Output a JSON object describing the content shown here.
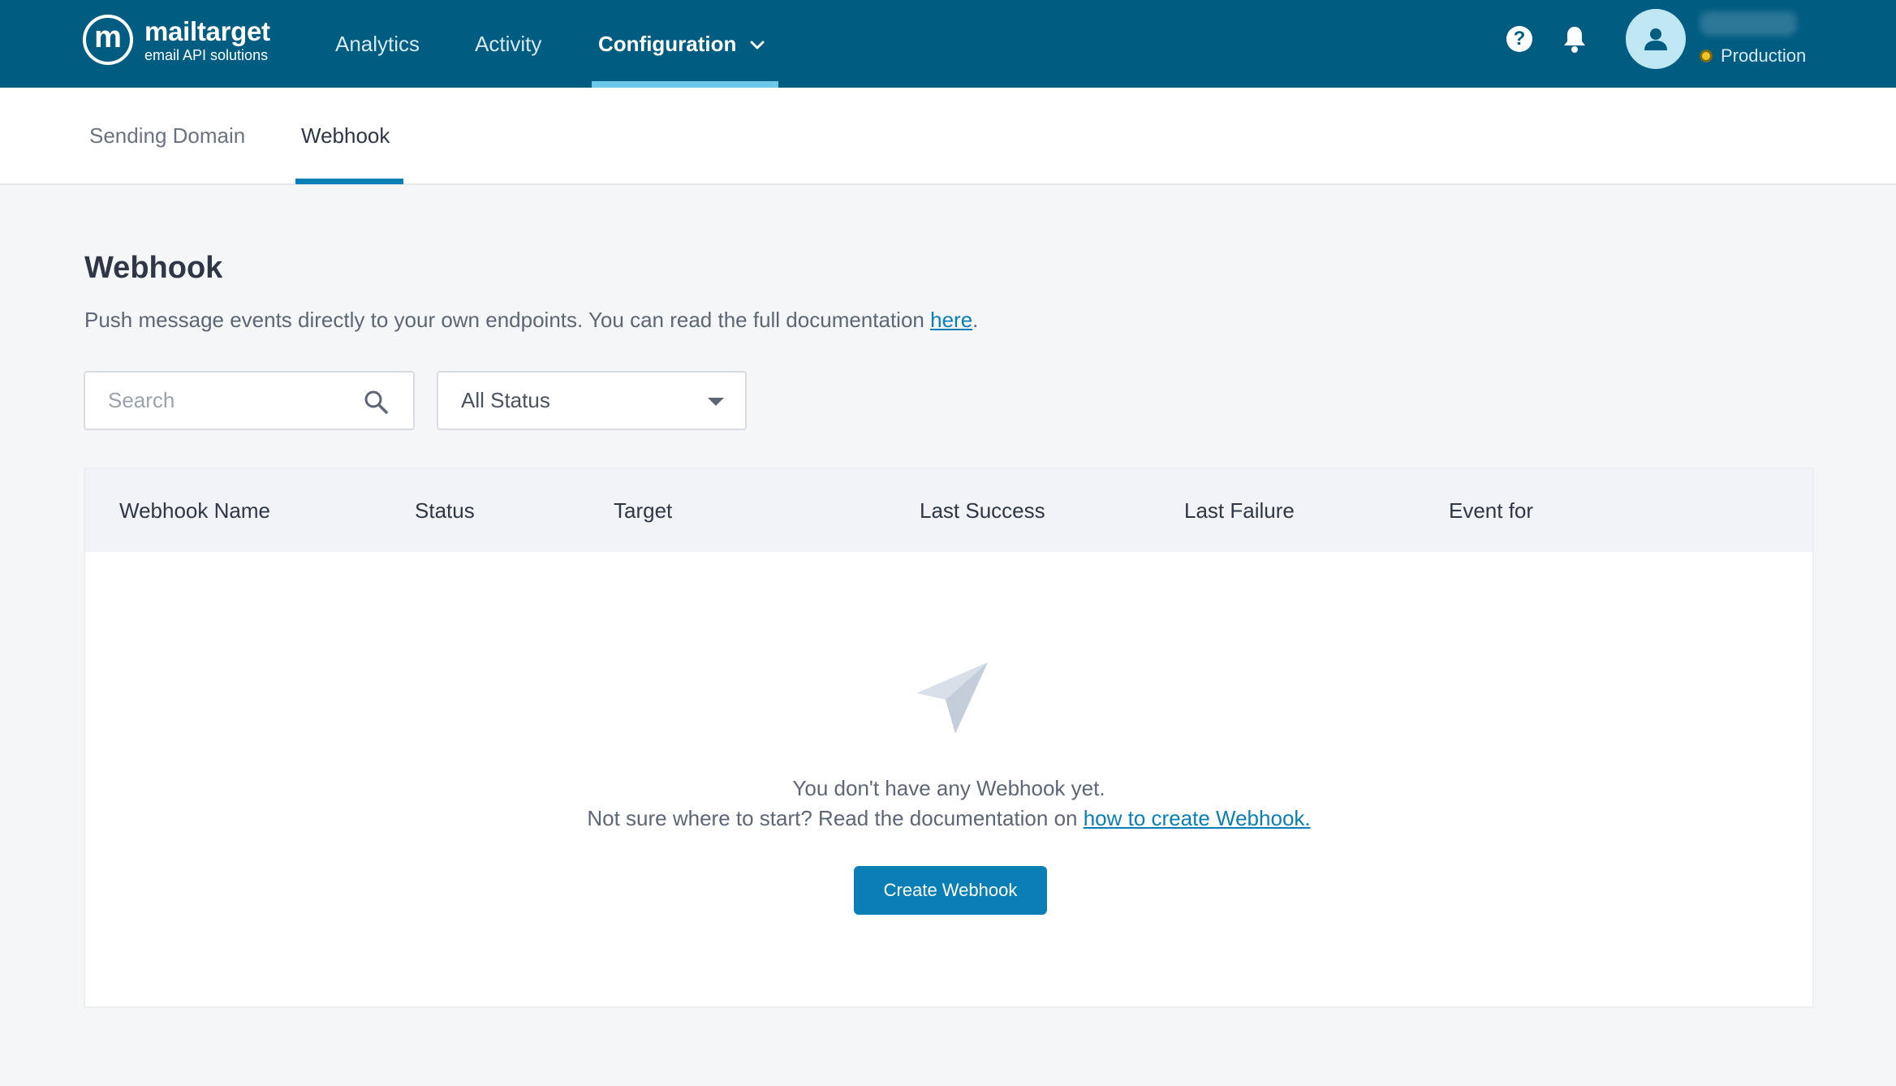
{
  "header": {
    "logo_mark": "m",
    "logo_name": "mailtarget",
    "logo_tagline": "email API solutions",
    "nav": [
      {
        "label": "Analytics"
      },
      {
        "label": "Activity"
      },
      {
        "label": "Configuration"
      }
    ],
    "active_nav": "Configuration",
    "help_glyph": "?",
    "environment": "Production",
    "env_color": "#f4c21a"
  },
  "subtabs": [
    {
      "label": "Sending Domain"
    },
    {
      "label": "Webhook"
    }
  ],
  "active_subtab": "Webhook",
  "main": {
    "title": "Webhook",
    "description": "Push message events directly to your own endpoints. You can read the full documentation ",
    "description_link": "here",
    "description_end": ".",
    "search_placeholder": "Search",
    "status_filter": "All Status",
    "table_columns": [
      "Webhook Name",
      "Status",
      "Target",
      "Last Success",
      "Last Failure",
      "Event for"
    ],
    "empty_title": "You don't have any Webhook yet.",
    "empty_help": "Not sure where to start? Read the documentation on ",
    "empty_help_link": "how to create Webhook.",
    "create_button": "Create Webhook"
  },
  "colors": {
    "topbar": "#005c80",
    "accent": "#0a7fb5",
    "nav_underline": "#6cc7e8"
  },
  "icons": [
    "help-icon",
    "bell-icon",
    "user-icon",
    "search-icon",
    "caret-down-icon",
    "chevron-down-icon",
    "paper-plane-icon"
  ]
}
